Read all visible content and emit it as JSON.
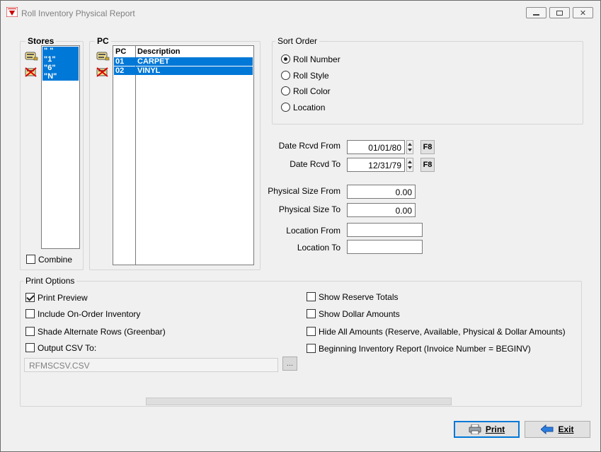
{
  "window": {
    "title": "Roll Inventory Physical Report",
    "controls": {
      "minimize": "▭",
      "maximize": "▣",
      "close": "✕"
    }
  },
  "stores": {
    "label": "Stores",
    "items": [
      "\" \"",
      "\"1\"",
      "\"6\"",
      "\"N\""
    ],
    "combine_label": "Combine"
  },
  "pc": {
    "label": "PC",
    "col_pc": "PC",
    "col_desc": "Description",
    "rows": [
      {
        "code": "01",
        "desc": "CARPET"
      },
      {
        "code": "02",
        "desc": "VINYL"
      }
    ]
  },
  "sort_order": {
    "label": "Sort Order",
    "options": [
      "Roll Number",
      "Roll Style",
      "Roll Color",
      "Location"
    ],
    "selected": "Roll Number"
  },
  "filters": {
    "date_from_label": "Date Rcvd From",
    "date_from_value": "01/01/80",
    "date_to_label": "Date Rcvd To",
    "date_to_value": "12/31/79",
    "f8_label": "F8",
    "size_from_label": "Physical Size From",
    "size_from_value": "0.00",
    "size_to_label": "Physical Size To",
    "size_to_value": "0.00",
    "loc_from_label": "Location From",
    "loc_from_value": "",
    "loc_to_label": "Location To",
    "loc_to_value": ""
  },
  "print_options": {
    "label": "Print Options",
    "print_preview": "Print Preview",
    "include_on_order": "Include On-Order Inventory",
    "shade_rows": "Shade Alternate Rows (Greenbar)",
    "output_csv": "Output CSV To:",
    "csv_path": "RFMSCSV.CSV",
    "browse": "...",
    "show_reserve": "Show Reserve Totals",
    "show_dollar": "Show Dollar Amounts",
    "hide_all": "Hide All Amounts  (Reserve, Available, Physical & Dollar Amounts)",
    "beginning_inv": "Beginning Inventory Report  (Invoice Number = BEGINV)"
  },
  "buttons": {
    "print": "Print",
    "exit": "Exit"
  },
  "colors": {
    "selection": "#0078d7",
    "window_bg": "#f0f0f0"
  }
}
